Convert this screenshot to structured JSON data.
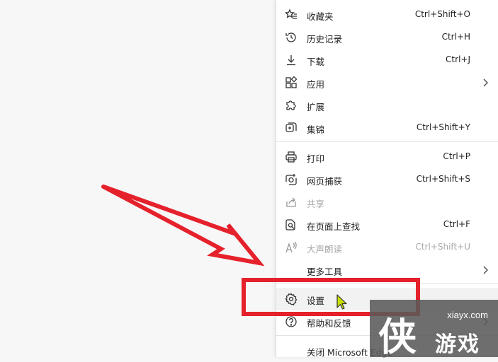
{
  "menu": {
    "favorites": {
      "label": "收藏夹",
      "shortcut": "Ctrl+Shift+O",
      "icon": "star-list-icon"
    },
    "history": {
      "label": "历史记录",
      "shortcut": "Ctrl+H",
      "icon": "history-icon"
    },
    "downloads": {
      "label": "下载",
      "shortcut": "Ctrl+J",
      "icon": "download-icon"
    },
    "apps": {
      "label": "应用",
      "icon": "apps-icon"
    },
    "extensions": {
      "label": "扩展",
      "icon": "puzzle-icon"
    },
    "collections": {
      "label": "集锦",
      "shortcut": "Ctrl+Shift+Y",
      "icon": "collections-icon"
    },
    "print": {
      "label": "打印",
      "shortcut": "Ctrl+P",
      "icon": "printer-icon"
    },
    "web_capture": {
      "label": "网页捕获",
      "shortcut": "Ctrl+Shift+S",
      "icon": "web-capture-icon"
    },
    "share": {
      "label": "共享",
      "icon": "share-icon",
      "disabled": true
    },
    "find": {
      "label": "在页面上查找",
      "shortcut": "Ctrl+F",
      "icon": "find-on-page-icon"
    },
    "read_aloud": {
      "label": "大声朗读",
      "shortcut": "Ctrl+Shift+U",
      "icon": "read-aloud-icon",
      "disabled": true
    },
    "more_tools": {
      "label": "更多工具"
    },
    "settings": {
      "label": "设置",
      "icon": "gear-icon"
    },
    "help": {
      "label": "帮助和反馈",
      "icon": "help-icon"
    },
    "close": {
      "label": "关闭 Microsoft Edge"
    }
  },
  "watermark": {
    "site": "xiayx.com",
    "char": "侠",
    "text": "游戏"
  },
  "colors": {
    "annotation_red": "#e5212b",
    "cursor_green": "#c8e000"
  }
}
